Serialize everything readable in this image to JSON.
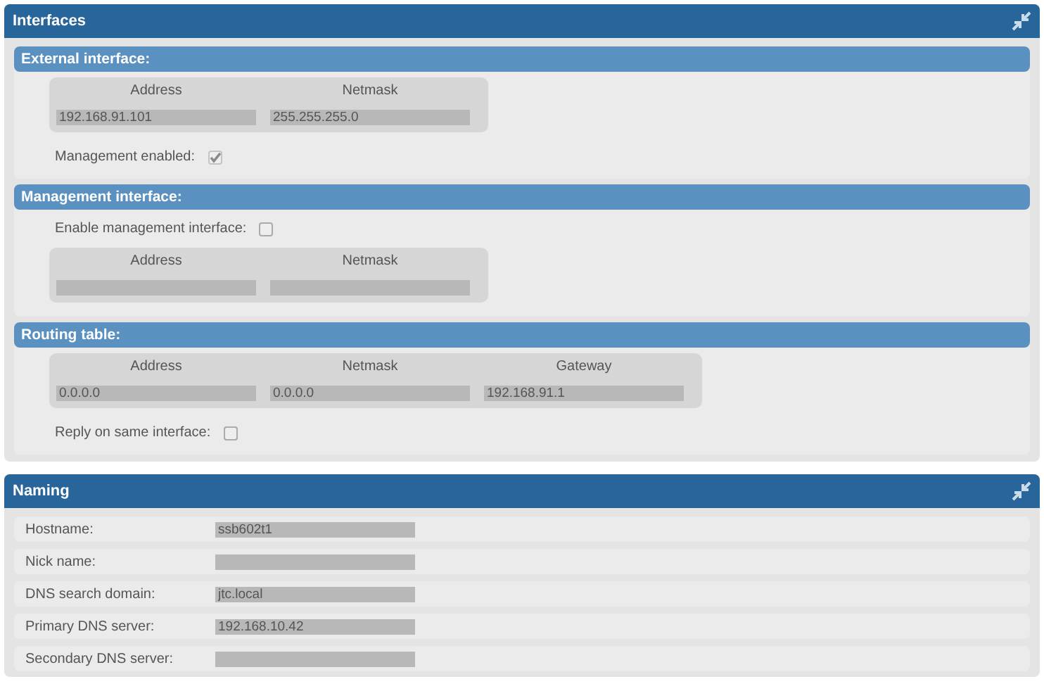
{
  "panels": [
    {
      "title": "Interfaces",
      "kind": "sections",
      "sections": [
        {
          "title": "External interface:",
          "items": [
            {
              "kind": "table",
              "columns": [
                "Address",
                "Netmask"
              ],
              "cells": [
                {
                  "value": "192.168.91.101"
                },
                {
                  "value": "255.255.255.0"
                }
              ]
            },
            {
              "kind": "checkbox",
              "label": "Management enabled:",
              "checked": true,
              "disabled": true
            }
          ]
        },
        {
          "title": "Management interface:",
          "items": [
            {
              "kind": "checkbox",
              "label": "Enable management interface:",
              "checked": false,
              "disabled": false
            },
            {
              "kind": "table",
              "columns": [
                "Address",
                "Netmask"
              ],
              "cells": [
                {},
                {}
              ]
            }
          ]
        },
        {
          "title": "Routing table:",
          "items": [
            {
              "kind": "table",
              "columns": [
                "Address",
                "Netmask",
                "Gateway"
              ],
              "cells": [
                {
                  "value": "0.0.0.0"
                },
                {
                  "value": "0.0.0.0"
                },
                {
                  "value": "192.168.91.1"
                }
              ]
            },
            {
              "kind": "checkbox",
              "label": "Reply on same interface:",
              "checked": false,
              "disabled": false
            }
          ]
        }
      ]
    },
    {
      "title": "Naming",
      "kind": "form",
      "rows": [
        {
          "label": "Hostname:",
          "value": "ssb602t1"
        },
        {
          "label": "Nick name:"
        },
        {
          "label": "DNS search domain:",
          "value": "jtc.local"
        },
        {
          "label": "Primary DNS server:",
          "value": "192.168.10.42"
        },
        {
          "label": "Secondary DNS server:"
        }
      ]
    }
  ]
}
